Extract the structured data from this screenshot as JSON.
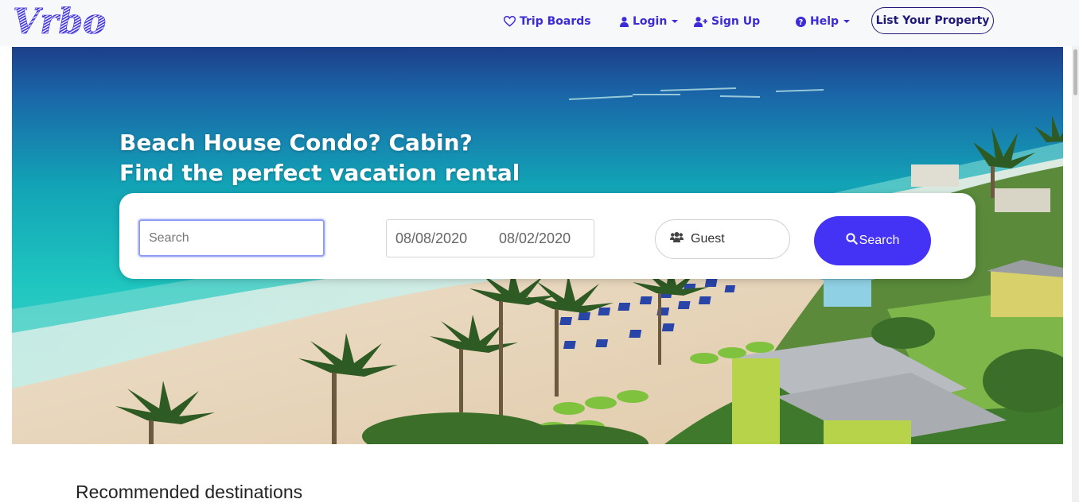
{
  "brand": {
    "logo_text": "Vrbo",
    "accent": "#3b2bd8",
    "button_color": "#4432f5"
  },
  "nav": {
    "trip_boards": {
      "label": "Trip Boards",
      "icon": "heart-icon"
    },
    "login": {
      "label": "Login",
      "icon": "user-icon"
    },
    "signup": {
      "label": "Sign Up",
      "icon": "user-plus-icon"
    },
    "help": {
      "label": "Help",
      "icon": "question-circle-icon"
    },
    "list_property": {
      "label": "List Your Property"
    }
  },
  "hero": {
    "headline_line1": "Beach House Condo? Cabin?",
    "headline_line2": "Find the perfect vacation rental",
    "image": "aerial beach resort with palm trees and turquoise sea"
  },
  "search": {
    "placeholder": "Search",
    "value": "",
    "checkin": "08/08/2020",
    "checkout": "08/02/2020",
    "guest_label": "Guest",
    "guest_icon": "users-icon",
    "button_label": "Search",
    "button_icon": "search-icon"
  },
  "sections": {
    "recommended_title": "Recommended destinations"
  }
}
